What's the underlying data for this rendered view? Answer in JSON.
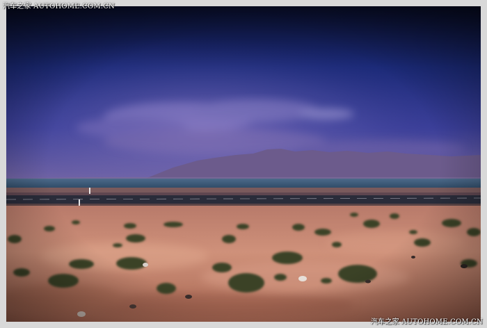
{
  "watermark": {
    "top_left": "汽车之家 AUTOHOME.COM.CN",
    "bottom_right": "汽车之家 AUTOHOME.COM.CN"
  },
  "photo": {
    "scene": "desert-road-lake-mountains",
    "colors": {
      "sky_top": "#0b1230",
      "sky_mid": "#2a3a8c",
      "sky_horizon": "#6a5a9e",
      "mountains": "#6b5a8a",
      "lake": "#3d5a78",
      "road": "#2b2d3a",
      "sand": "#c98a72",
      "sand_dark": "#8a5a4a",
      "shrub": "#3d4a2a"
    }
  }
}
